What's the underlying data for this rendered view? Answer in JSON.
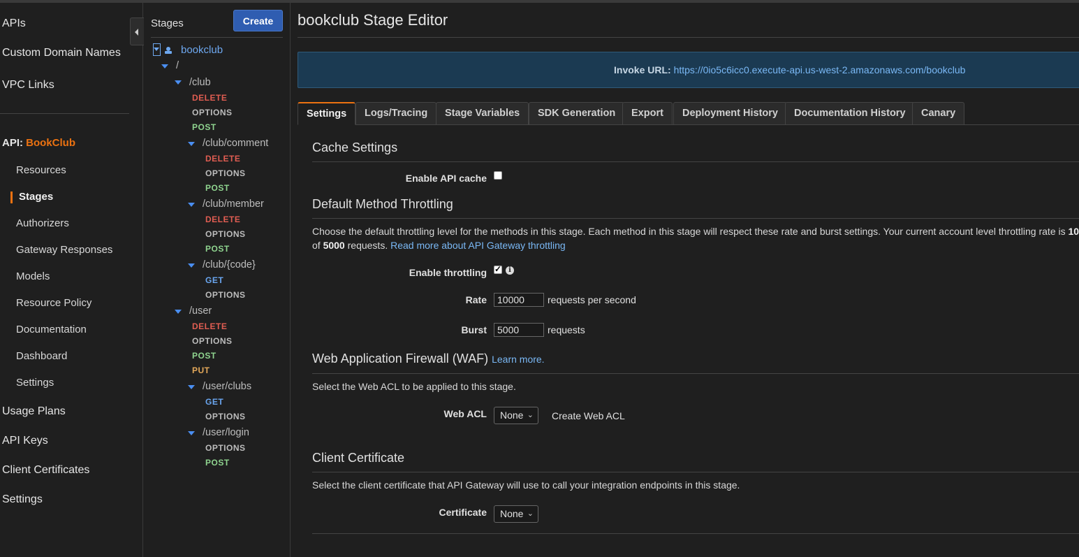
{
  "nav": {
    "top": [
      "APIs",
      "Custom Domain Names",
      "VPC Links"
    ],
    "api_prefix": "API:",
    "api_name": "BookClub",
    "sub": [
      "Resources",
      "Stages",
      "Authorizers",
      "Gateway Responses",
      "Models",
      "Resource Policy",
      "Documentation",
      "Dashboard",
      "Settings"
    ],
    "bottom": [
      "Usage Plans",
      "API Keys",
      "Client Certificates",
      "Settings"
    ]
  },
  "stages": {
    "title": "Stages",
    "create_label": "Create",
    "stage_name": "bookclub",
    "root": "/",
    "paths": [
      "/club",
      "/club/comment",
      "/club/member",
      "/club/{code}",
      "/user",
      "/user/clubs",
      "/user/login"
    ],
    "methods": {
      "club": [
        "DELETE",
        "OPTIONS",
        "POST"
      ],
      "club_comment": [
        "DELETE",
        "OPTIONS",
        "POST"
      ],
      "club_member": [
        "DELETE",
        "OPTIONS",
        "POST"
      ],
      "club_code": [
        "GET",
        "OPTIONS"
      ],
      "user": [
        "DELETE",
        "OPTIONS",
        "POST",
        "PUT"
      ],
      "user_clubs": [
        "GET",
        "OPTIONS"
      ],
      "user_login": [
        "OPTIONS",
        "POST"
      ]
    }
  },
  "main": {
    "title": "bookclub Stage Editor",
    "invoke_label": "Invoke URL:",
    "invoke_url": "https://0io5c6icc0.execute-api.us-west-2.amazonaws.com/bookclub",
    "tabs": [
      "Settings",
      "Logs/Tracing",
      "Stage Variables",
      "SDK Generation",
      "Export",
      "Deployment History",
      "Documentation History",
      "Canary"
    ],
    "cache": {
      "title": "Cache Settings",
      "enable_label": "Enable API cache",
      "enabled": false
    },
    "throttling": {
      "title": "Default Method Throttling",
      "desc_part1": "Choose the default throttling level for the methods in this stage. Each method in this stage will respect these rate and burst settings. Your current account level throttling rate is",
      "desc_rate": "10",
      "desc_part2": "of",
      "desc_burst": "5000",
      "desc_part3": "requests.",
      "read_more": "Read more about API Gateway throttling",
      "enable_label": "Enable throttling",
      "enabled": true,
      "rate_label": "Rate",
      "rate_value": "10000",
      "rate_unit": "requests per second",
      "burst_label": "Burst",
      "burst_value": "5000",
      "burst_unit": "requests"
    },
    "waf": {
      "title": "Web Application Firewall (WAF)",
      "learn_more": "Learn more.",
      "desc": "Select the Web ACL to be applied to this stage.",
      "acl_label": "Web ACL",
      "acl_value": "None",
      "create_acl": "Create Web ACL"
    },
    "cert": {
      "title": "Client Certificate",
      "desc": "Select the client certificate that API Gateway will use to call your integration endpoints in this stage.",
      "label": "Certificate",
      "value": "None"
    }
  },
  "colors": {
    "accent": "#ec7211",
    "link": "#7ab8f5",
    "delete": "#e05d52",
    "post": "#8fd48f",
    "get": "#6aa6f0",
    "put": "#e3a85a"
  }
}
